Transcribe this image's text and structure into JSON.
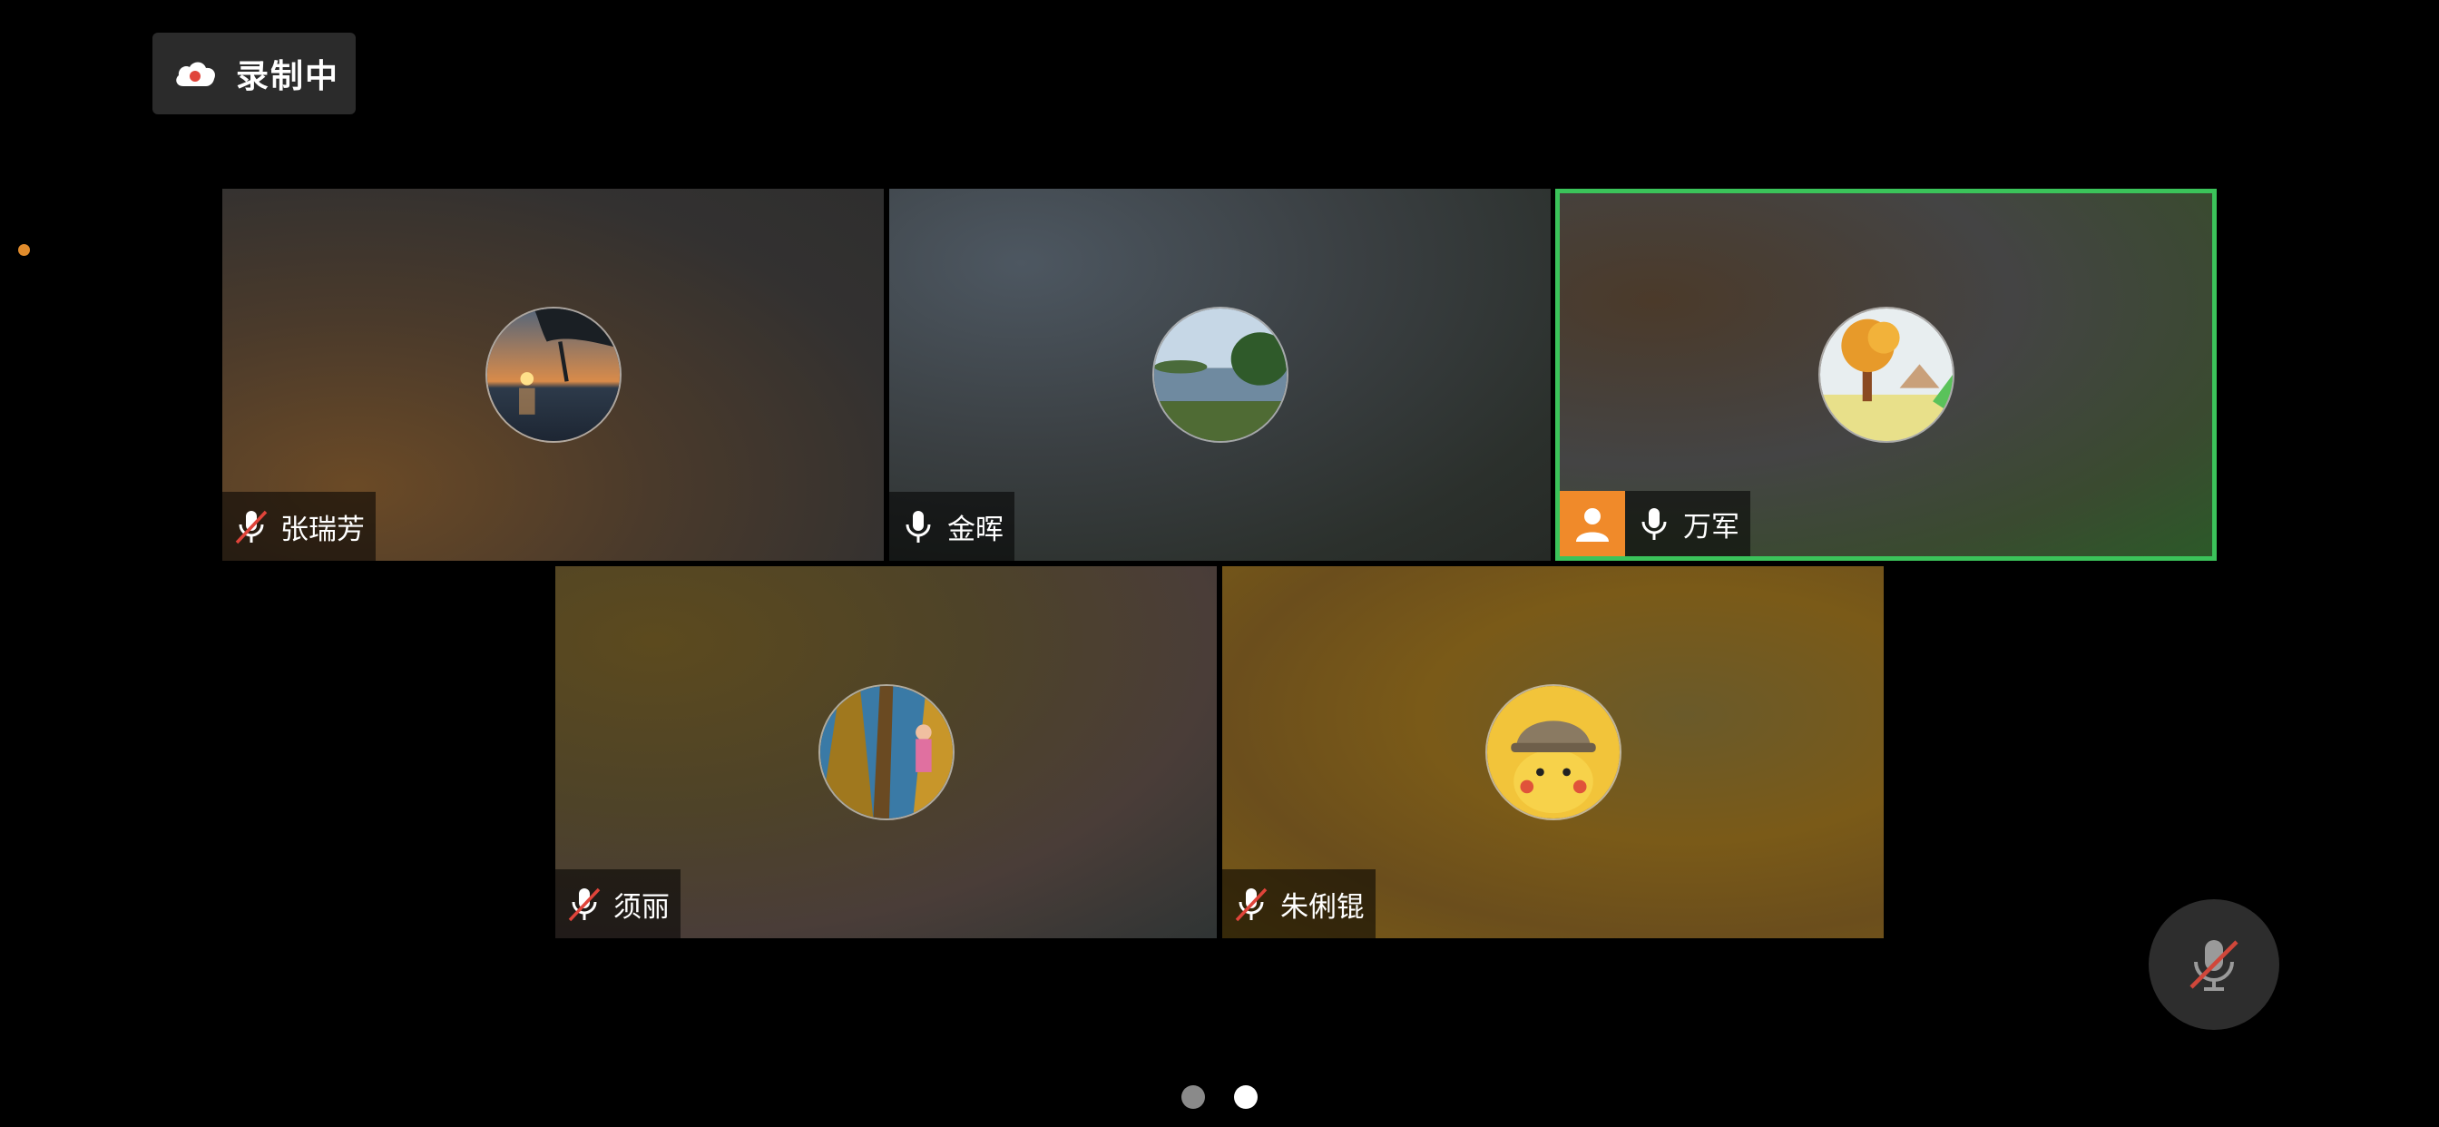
{
  "recording": {
    "label": "录制中",
    "icon": "cloud-record-icon"
  },
  "participants": [
    {
      "name": "张瑞芳",
      "mic": "muted",
      "avatar": "sunset-sea-avatar"
    },
    {
      "name": "金晖",
      "mic": "on",
      "avatar": "lake-landscape-avatar"
    },
    {
      "name": "万军",
      "mic": "on",
      "avatar": "autumn-tree-avatar",
      "host": true,
      "speaking": true
    },
    {
      "name": "须丽",
      "mic": "muted",
      "avatar": "forest-person-avatar"
    },
    {
      "name": "朱俐锟",
      "mic": "muted",
      "avatar": "pikachu-detective-avatar"
    }
  ],
  "controls": {
    "mic_button": "muted"
  },
  "pagination": {
    "pages": 2,
    "current": 2
  },
  "colors": {
    "active_border": "#3bc35a",
    "host_badge": "#f08a2a",
    "muted_slash": "#e0443a"
  }
}
